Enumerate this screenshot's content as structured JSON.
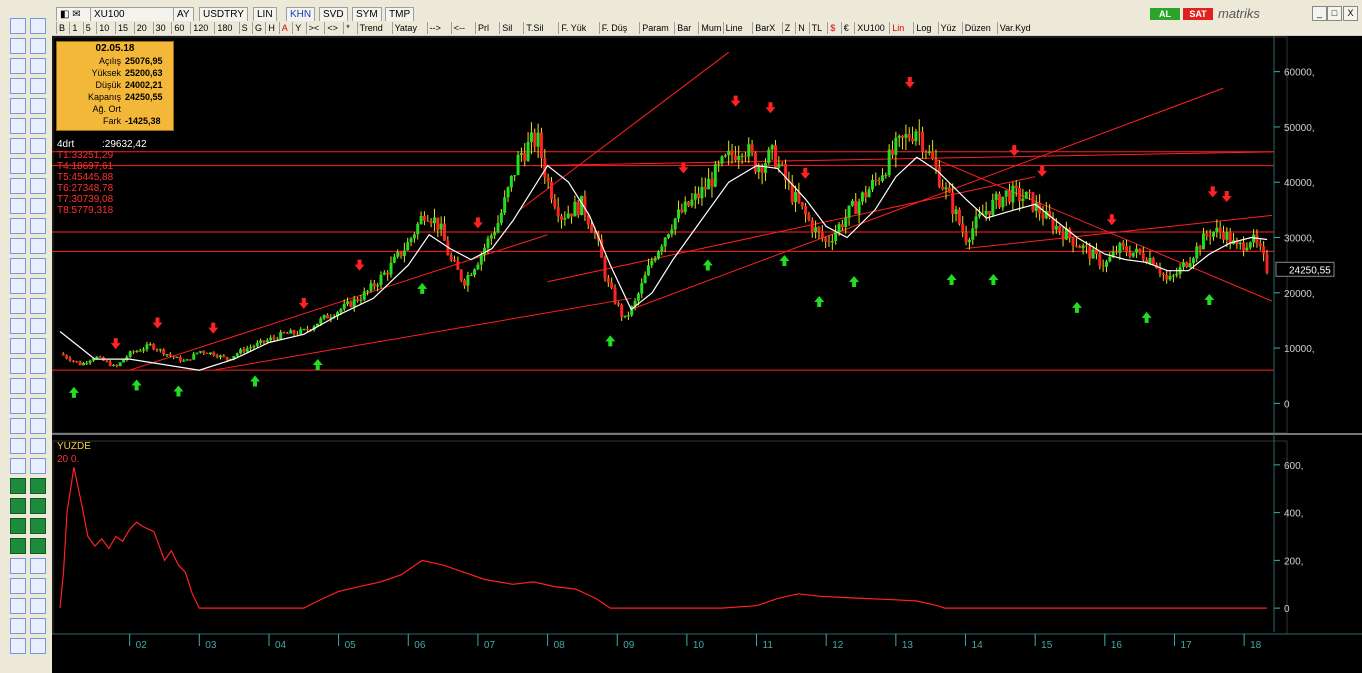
{
  "window": {
    "symbol": "XU100",
    "tabs": [
      "AY",
      "USDTRY",
      "LIN",
      "KHN",
      "SVD",
      "SYM",
      "TMP"
    ],
    "al_label": "AL",
    "sat_label": "SAT",
    "brand": "matriks",
    "close_glyph": "X",
    "min_glyph": "_",
    "max_glyph": "□"
  },
  "toolbar": {
    "items": [
      "B",
      "1",
      "5",
      "10",
      "15",
      "20",
      "30",
      "60",
      "120",
      "180",
      "S",
      "G",
      "H",
      "A",
      "Y",
      "><",
      "<>",
      "*",
      "Trend",
      "Yatay",
      "-->",
      "<--",
      "Prl",
      "Sil",
      "T.Sil",
      "F. Yük",
      "F. Düş",
      "Param",
      "Bar",
      "Mum",
      "Line",
      "BarX",
      "Z",
      "N",
      "TL",
      "$",
      "€",
      "XU100",
      "Lin",
      "Log",
      "Yüz",
      "Düzen",
      "Var.Kyd"
    ]
  },
  "infobox": {
    "date": "02.05.18",
    "rows": [
      {
        "k": "Açılış",
        "v": "25076,95"
      },
      {
        "k": "Yüksek",
        "v": "25200,63"
      },
      {
        "k": "Düşük",
        "v": "24002,21"
      },
      {
        "k": "Kapanış",
        "v": "24250,55"
      },
      {
        "k": "Ağ. Ort",
        "v": ""
      },
      {
        "k": "Fark",
        "v": "-1425,38"
      }
    ]
  },
  "indicator_lines": [
    {
      "text": "4drt          :29632,42",
      "color": "#ffffff"
    },
    {
      "text": "T1:33251,29",
      "color": "#ff3030"
    },
    {
      "text": "T4:18697,61",
      "color": "#ff3030"
    },
    {
      "text": "T5:45445,88",
      "color": "#ff3030"
    },
    {
      "text": "T6:27348,78",
      "color": "#ff3030"
    },
    {
      "text": "T7:30739,08",
      "color": "#ff3030"
    },
    {
      "text": "T8:5779,318",
      "color": "#ff3030"
    }
  ],
  "last_price_label": "24250,55",
  "sub_panel": {
    "title": "YUZDE",
    "params": "20        0."
  },
  "colors": {
    "up": "#22dd22",
    "down": "#ff2222",
    "ma": "#ffffff",
    "trend": "#ff2020",
    "axis": "#4aa",
    "sub": "#ff2020"
  },
  "chart_data": [
    {
      "type": "candlestick",
      "title": "XU100",
      "ylim": [
        -5000,
        65000
      ],
      "y_ticks": [
        0,
        10000,
        20000,
        30000,
        40000,
        50000,
        60000
      ],
      "y_tick_labels": [
        "0",
        "10000,",
        "20000,",
        "30000,",
        "40000,",
        "50000,",
        "60000,"
      ],
      "x_tick_labels": [
        "02",
        "03",
        "04",
        "05",
        "06",
        "07",
        "08",
        "09",
        "10",
        "11",
        "12",
        "13",
        "14",
        "15",
        "16",
        "17",
        "18"
      ],
      "x_range": [
        2001.0,
        2018.4
      ],
      "close_path": [
        [
          2001.0,
          9000
        ],
        [
          2001.3,
          7000
        ],
        [
          2001.5,
          8500
        ],
        [
          2001.8,
          6500
        ],
        [
          2002.0,
          9000
        ],
        [
          2002.3,
          10500
        ],
        [
          2002.6,
          8500
        ],
        [
          2002.8,
          7500
        ],
        [
          2003.0,
          9500
        ],
        [
          2003.2,
          9000
        ],
        [
          2003.4,
          8000
        ],
        [
          2003.6,
          9500
        ],
        [
          2003.9,
          11000
        ],
        [
          2004.2,
          12500
        ],
        [
          2004.5,
          13000
        ],
        [
          2004.8,
          15500
        ],
        [
          2005.1,
          17500
        ],
        [
          2005.4,
          20000
        ],
        [
          2005.7,
          24000
        ],
        [
          2006.0,
          29000
        ],
        [
          2006.25,
          35000
        ],
        [
          2006.45,
          32000
        ],
        [
          2006.6,
          26000
        ],
        [
          2006.8,
          22000
        ],
        [
          2007.0,
          26000
        ],
        [
          2007.3,
          33000
        ],
        [
          2007.6,
          45000
        ],
        [
          2007.85,
          48000
        ],
        [
          2008.0,
          40000
        ],
        [
          2008.2,
          34000
        ],
        [
          2008.5,
          36000
        ],
        [
          2008.7,
          30000
        ],
        [
          2008.85,
          22000
        ],
        [
          2009.1,
          15000
        ],
        [
          2009.25,
          18000
        ],
        [
          2009.5,
          26000
        ],
        [
          2009.8,
          33000
        ],
        [
          2010.2,
          38000
        ],
        [
          2010.5,
          43000
        ],
        [
          2010.8,
          47000
        ],
        [
          2011.0,
          43000
        ],
        [
          2011.25,
          45000
        ],
        [
          2011.5,
          38000
        ],
        [
          2011.8,
          32000
        ],
        [
          2012.0,
          29000
        ],
        [
          2012.3,
          34000
        ],
        [
          2012.7,
          40000
        ],
        [
          2013.0,
          46000
        ],
        [
          2013.3,
          50000
        ],
        [
          2013.55,
          43000
        ],
        [
          2013.8,
          36000
        ],
        [
          2014.0,
          30000
        ],
        [
          2014.3,
          35000
        ],
        [
          2014.6,
          38000
        ],
        [
          2014.9,
          37000
        ],
        [
          2015.2,
          33000
        ],
        [
          2015.5,
          30000
        ],
        [
          2015.8,
          27000
        ],
        [
          2016.0,
          25000
        ],
        [
          2016.2,
          28000
        ],
        [
          2016.5,
          27000
        ],
        [
          2016.7,
          26000
        ],
        [
          2016.9,
          22000
        ],
        [
          2017.0,
          23000
        ],
        [
          2017.2,
          26000
        ],
        [
          2017.5,
          31000
        ],
        [
          2017.7,
          31000
        ],
        [
          2017.9,
          28000
        ],
        [
          2018.1,
          30000
        ],
        [
          2018.25,
          27000
        ],
        [
          2018.33,
          24250
        ]
      ],
      "moving_average": [
        [
          2001.0,
          13000
        ],
        [
          2001.5,
          8000
        ],
        [
          2002.0,
          8000
        ],
        [
          2003.0,
          6000
        ],
        [
          2003.5,
          8000
        ],
        [
          2004.0,
          11000
        ],
        [
          2004.5,
          12500
        ],
        [
          2005.0,
          16000
        ],
        [
          2005.5,
          19000
        ],
        [
          2006.0,
          25000
        ],
        [
          2006.3,
          30500
        ],
        [
          2006.6,
          28000
        ],
        [
          2006.9,
          26000
        ],
        [
          2007.2,
          28000
        ],
        [
          2007.5,
          33000
        ],
        [
          2007.8,
          39000
        ],
        [
          2008.0,
          43000
        ],
        [
          2008.3,
          40000
        ],
        [
          2008.6,
          34000
        ],
        [
          2008.9,
          25000
        ],
        [
          2009.2,
          17000
        ],
        [
          2009.5,
          20000
        ],
        [
          2009.8,
          26000
        ],
        [
          2010.2,
          33000
        ],
        [
          2010.6,
          40000
        ],
        [
          2011.0,
          43000
        ],
        [
          2011.3,
          42500
        ],
        [
          2011.7,
          37000
        ],
        [
          2012.0,
          32000
        ],
        [
          2012.3,
          30000
        ],
        [
          2012.7,
          35000
        ],
        [
          2013.0,
          41000
        ],
        [
          2013.3,
          44500
        ],
        [
          2013.6,
          42000
        ],
        [
          2014.0,
          37000
        ],
        [
          2014.3,
          33500
        ],
        [
          2014.7,
          35000
        ],
        [
          2015.0,
          36000
        ],
        [
          2015.3,
          33000
        ],
        [
          2015.6,
          30000
        ],
        [
          2016.0,
          27000
        ],
        [
          2016.3,
          26000
        ],
        [
          2016.6,
          25500
        ],
        [
          2016.9,
          24000
        ],
        [
          2017.2,
          24000
        ],
        [
          2017.5,
          27000
        ],
        [
          2017.8,
          29000
        ],
        [
          2018.1,
          30000
        ],
        [
          2018.33,
          29632
        ]
      ],
      "horizontal_lines": [
        6000,
        27500,
        31000,
        43000,
        45500
      ],
      "trend_lines": [
        [
          [
            2002.0,
            6000
          ],
          [
            2008.0,
            30500
          ]
        ],
        [
          [
            2007.6,
            35000
          ],
          [
            2010.6,
            63500
          ]
        ],
        [
          [
            2003.2,
            6000
          ],
          [
            2009.2,
            19000
          ]
        ],
        [
          [
            2008.0,
            22000
          ],
          [
            2015.0,
            41000
          ]
        ],
        [
          [
            2009.2,
            17000
          ],
          [
            2017.7,
            57000
          ]
        ],
        [
          [
            2014.0,
            28000
          ],
          [
            2018.4,
            34000
          ]
        ],
        [
          [
            2013.6,
            44000
          ],
          [
            2018.4,
            18500
          ]
        ],
        [
          [
            2007.8,
            43000
          ],
          [
            2018.4,
            45500
          ]
        ]
      ],
      "buy_signals": [
        2001.2,
        2002.1,
        2002.7,
        2003.8,
        2004.7,
        2006.2,
        2008.9,
        2010.3,
        2011.4,
        2011.9,
        2012.4,
        2013.8,
        2014.4,
        2015.6,
        2016.6,
        2017.5
      ],
      "sell_signals": [
        2001.8,
        2002.4,
        2003.2,
        2004.5,
        2005.3,
        2007.0,
        2009.95,
        2010.7,
        2011.2,
        2011.7,
        2013.2,
        2014.7,
        2015.1,
        2016.1,
        2017.55,
        2017.75
      ]
    },
    {
      "type": "line",
      "title": "YUZDE",
      "ylim": [
        -100,
        700
      ],
      "y_ticks": [
        0,
        200,
        400,
        600
      ],
      "y_tick_labels": [
        "0",
        "200,",
        "400,",
        "600,"
      ],
      "series": [
        {
          "values": [
            [
              2001.0,
              0
            ],
            [
              2001.05,
              150
            ],
            [
              2001.1,
              400
            ],
            [
              2001.2,
              590
            ],
            [
              2001.3,
              450
            ],
            [
              2001.4,
              300
            ],
            [
              2001.5,
              260
            ],
            [
              2001.6,
              290
            ],
            [
              2001.7,
              250
            ],
            [
              2001.8,
              300
            ],
            [
              2001.9,
              280
            ],
            [
              2002.0,
              330
            ],
            [
              2002.1,
              360
            ],
            [
              2002.2,
              340
            ],
            [
              2002.35,
              320
            ],
            [
              2002.5,
              200
            ],
            [
              2002.6,
              240
            ],
            [
              2002.7,
              180
            ],
            [
              2002.8,
              150
            ],
            [
              2002.9,
              60
            ],
            [
              2003.0,
              0
            ],
            [
              2003.5,
              0
            ],
            [
              2004.0,
              0
            ],
            [
              2004.5,
              0
            ],
            [
              2004.7,
              30
            ],
            [
              2005.0,
              70
            ],
            [
              2005.3,
              90
            ],
            [
              2005.6,
              110
            ],
            [
              2005.9,
              140
            ],
            [
              2006.2,
              200
            ],
            [
              2006.5,
              180
            ],
            [
              2006.8,
              150
            ],
            [
              2007.1,
              120
            ],
            [
              2007.5,
              100
            ],
            [
              2007.8,
              110
            ],
            [
              2008.1,
              90
            ],
            [
              2008.4,
              80
            ],
            [
              2008.7,
              40
            ],
            [
              2008.9,
              0
            ],
            [
              2009.5,
              0
            ],
            [
              2010.0,
              0
            ],
            [
              2010.5,
              0
            ],
            [
              2011.0,
              10
            ],
            [
              2011.3,
              40
            ],
            [
              2011.6,
              60
            ],
            [
              2011.9,
              50
            ],
            [
              2012.2,
              45
            ],
            [
              2012.6,
              40
            ],
            [
              2013.0,
              35
            ],
            [
              2013.3,
              30
            ],
            [
              2013.6,
              10
            ],
            [
              2013.7,
              0
            ],
            [
              2014.5,
              0
            ],
            [
              2015.5,
              0
            ],
            [
              2016.5,
              0
            ],
            [
              2017.5,
              0
            ],
            [
              2018.33,
              0
            ]
          ]
        }
      ]
    }
  ]
}
